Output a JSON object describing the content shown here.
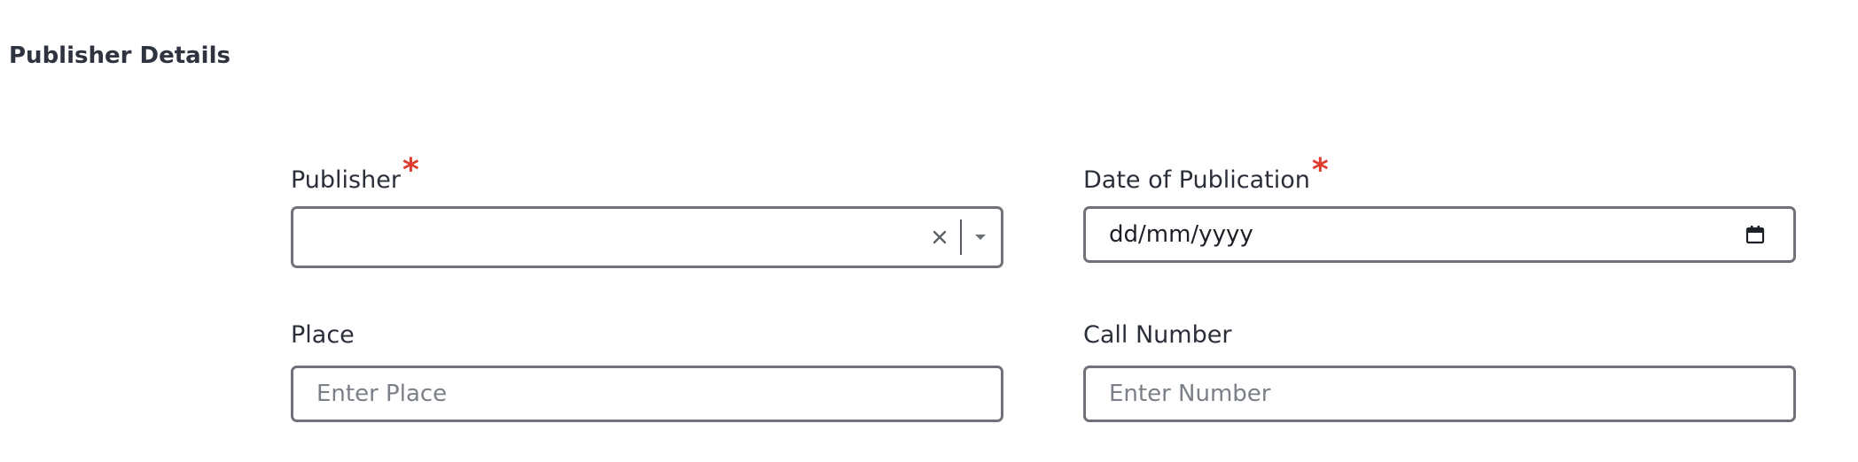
{
  "section": {
    "title": "Publisher Details"
  },
  "fields": {
    "publisher": {
      "label": "Publisher",
      "required_mark": "*",
      "value": ""
    },
    "date_of_publication": {
      "label": "Date of Publication",
      "required_mark": "*",
      "placeholder": "dd/mm/yyyy"
    },
    "place": {
      "label": "Place",
      "placeholder": "Enter Place",
      "value": ""
    },
    "call_number": {
      "label": "Call Number",
      "placeholder": "Enter Number",
      "value": ""
    }
  },
  "icons": {
    "clear": "close-icon",
    "dropdown": "chevron-down-icon",
    "calendar": "calendar-icon"
  },
  "colors": {
    "required": "#e03b2c",
    "border": "#6f7278",
    "text": "#2b2f3a",
    "placeholder": "#7b7f87"
  }
}
